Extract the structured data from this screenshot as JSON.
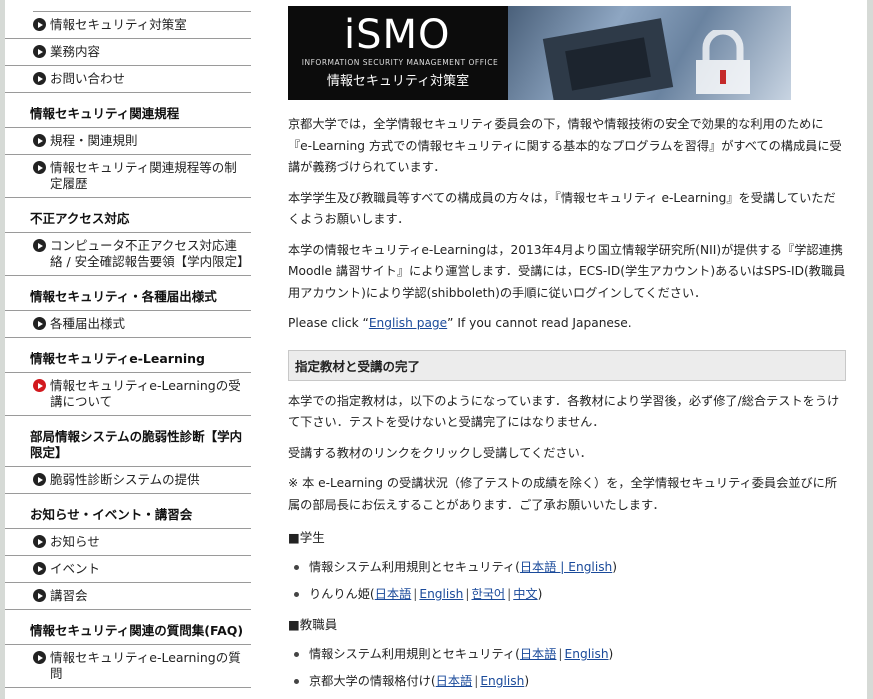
{
  "sidebar": {
    "top_items": [
      {
        "label": "情報セキュリティ対策室"
      },
      {
        "label": "業務内容"
      },
      {
        "label": "お問い合わせ"
      }
    ],
    "sections": [
      {
        "title": "情報セキュリティ関連規程",
        "items": [
          "規程・関連規則",
          "情報セキュリティ関連規程等の制定履歴"
        ]
      },
      {
        "title": "不正アクセス対応",
        "items": [
          "コンピュータ不正アクセス対応連絡 / 安全確認報告要領【学内限定】"
        ]
      },
      {
        "title": "情報セキュリティ・各種届出様式",
        "items": [
          "各種届出様式"
        ]
      },
      {
        "title": "情報セキュリティe-Learning",
        "items": [
          "情報セキュリティe-Learningの受講について"
        ]
      },
      {
        "title": "部局情報システムの脆弱性診断【学内限定】",
        "items": [
          "脆弱性診断システムの提供"
        ]
      },
      {
        "title": "お知らせ・イベント・講習会",
        "items": [
          "お知らせ",
          "イベント",
          "講習会"
        ]
      },
      {
        "title": "情報セキュリティ関連の質問集(FAQ)",
        "items": [
          "情報セキュリティe-Learningの質問"
        ]
      }
    ]
  },
  "banner": {
    "logo": "iSMO",
    "org": "INFORMATION SECURITY MANAGEMENT OFFICE",
    "jp": "情報セキュリティ対策室"
  },
  "main": {
    "p1": "京都大学では，全学情報セキュリティ委員会の下，情報や情報技術の安全で効果的な利用のために『e-Learning 方式での情報セキュリティに関する基本的なプログラムを習得』がすべての構成員に受講が義務づけられています．",
    "p2": "本学学生及び教職員等すべての構成員の方々は，『情報セキュリティ e-Learning』を受講していただくようお願いします．",
    "p3": "本学の情報セキュリティe-Learningは，2013年4月より国立情報学研究所(NII)が提供する『学認連携Moodle 講習サイト』により運営します．受講には，ECS-ID(学生アカウント)あるいはSPS-ID(教職員用アカウント)により学認(shibboleth)の手順に従いログインしてください．",
    "p4_pre": "Please click “",
    "p4_link": "English page",
    "p4_post": "” If you cannot read Japanese.",
    "section_title": "指定教材と受講の完了",
    "p5": "本学での指定教材は，以下のようになっています．各教材により学習後，必ず修了/総合テストをうけて下さい．テストを受けないと受講完了にはなりません．",
    "p6": "受講する教材のリンクをクリックし受講してください．",
    "p7": "※ 本 e-Learning の受講状況（修了テストの成績を除く）を，全学情報セキュリティ委員会並びに所属の部局長にお伝えすることがあります．ご了承お願いいたします．",
    "students_head": "■学生",
    "staff_head": "■教職員",
    "s1_text": "情報システム利用規則とセキュリティ(",
    "s1_link": "日本語 | English",
    "s1_close": ")",
    "s2_text": "りんりん姫(",
    "s2_l1": "日本語",
    "s2_l2": "English",
    "s2_l3": "한국어",
    "s2_l4": "中文",
    "s2_close": ")",
    "t1_text": "情報システム利用規則とセキュリティ(",
    "t1_l1": "日本語",
    "t1_l2": "English",
    "t1_close": ")",
    "t2_text": "京都大学の情報格付け(",
    "t2_l1": "日本語",
    "t2_l2": "English",
    "t2_close": ")",
    "separator": "|"
  },
  "colors": {
    "active_bullet": "#d2191e",
    "link": "#1a4a9a",
    "section_bg": "#ececec"
  }
}
